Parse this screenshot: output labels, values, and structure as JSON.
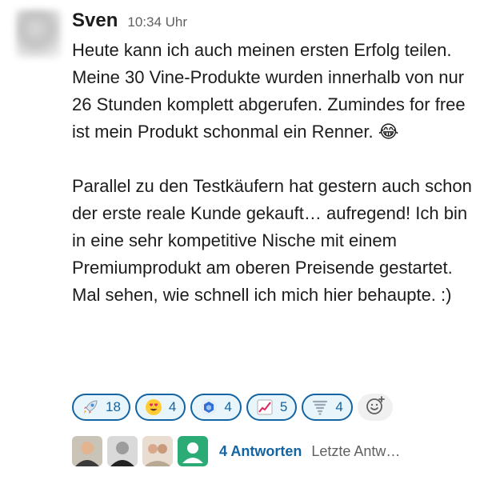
{
  "message": {
    "sender": "Sven",
    "time": "10:34 Uhr",
    "paragraph1": "Heute kann ich auch meinen ersten Erfolg teilen. Meine 30 Vine-Produkte wurden innerhalb von nur 26 Stunden komplett abgerufen. Zumindes for free ist mein Produkt schonmal ein Renner.",
    "paragraph1_emoji": "😂",
    "paragraph2": "Parallel zu den Testkäufern hat gestern auch schon der erste reale Kunde gekauft… aufregend! Ich bin in eine sehr kompetitive Nische mit einem Premiumprodukt am oberen Preisende gestartet. Mal sehen, wie schnell ich mich hier behaupte. :)"
  },
  "reactions": [
    {
      "icon": "rocket-icon",
      "count": "18"
    },
    {
      "icon": "heart-eyes-icon",
      "count": "4"
    },
    {
      "icon": "hexagon-icon",
      "count": "4"
    },
    {
      "icon": "chart-increasing-icon",
      "count": "5"
    },
    {
      "icon": "tornado-icon",
      "count": "4"
    }
  ],
  "thread": {
    "replies_label": "4 Antworten",
    "last_reply_label": "Letzte Antw…"
  },
  "colors": {
    "link": "#1264a3",
    "reaction_bg": "#e8f5fa",
    "muted": "#616061"
  }
}
